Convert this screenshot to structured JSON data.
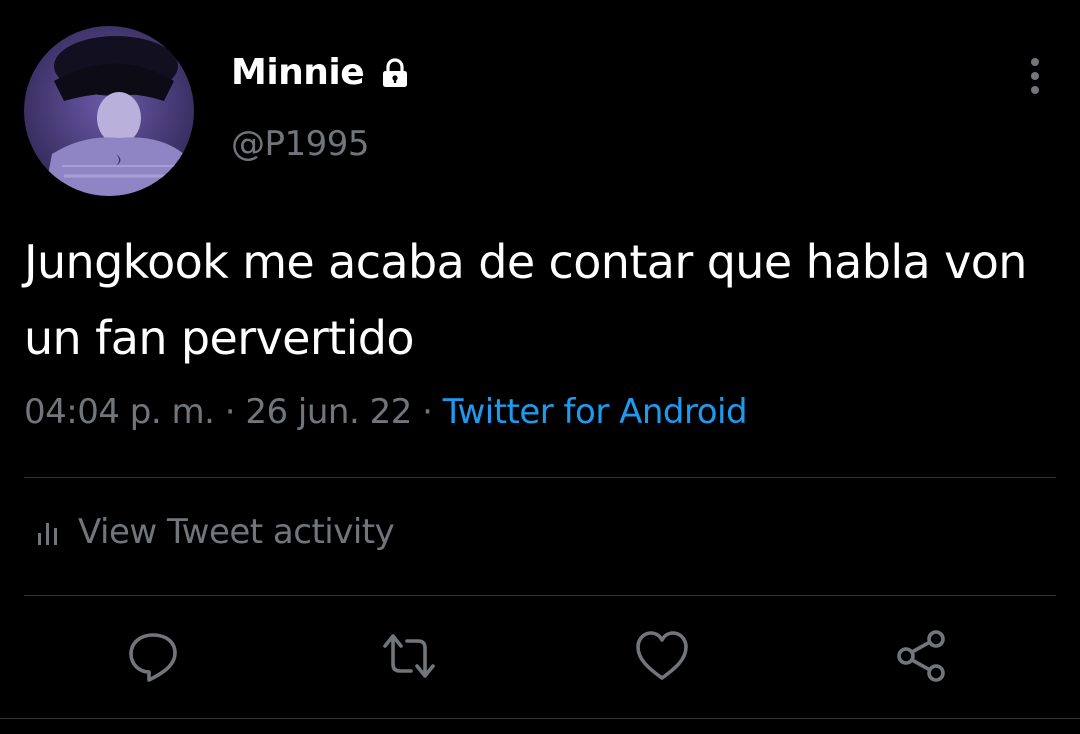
{
  "user": {
    "display_name": "Minnie",
    "handle": "@P1995",
    "avatar_icon": "avatar-image",
    "protected_icon": "lock-icon"
  },
  "tweet": {
    "text": "Jungkook me acaba de contar que habla von un fan pervertido",
    "time": "04:04 p. m.",
    "separator": "·",
    "date": "26 jun. 22",
    "source": "Twitter for Android"
  },
  "activity": {
    "label": "View Tweet activity",
    "icon": "bar-chart-icon"
  },
  "actions": [
    {
      "name": "reply",
      "icon": "reply-icon"
    },
    {
      "name": "retweet",
      "icon": "retweet-icon"
    },
    {
      "name": "like",
      "icon": "heart-icon"
    },
    {
      "name": "share",
      "icon": "share-icon"
    }
  ],
  "colors": {
    "background": "#000000",
    "text_primary": "#ffffff",
    "text_secondary": "#71767b",
    "link": "#1d9bf0",
    "divider": "#2f3336"
  }
}
